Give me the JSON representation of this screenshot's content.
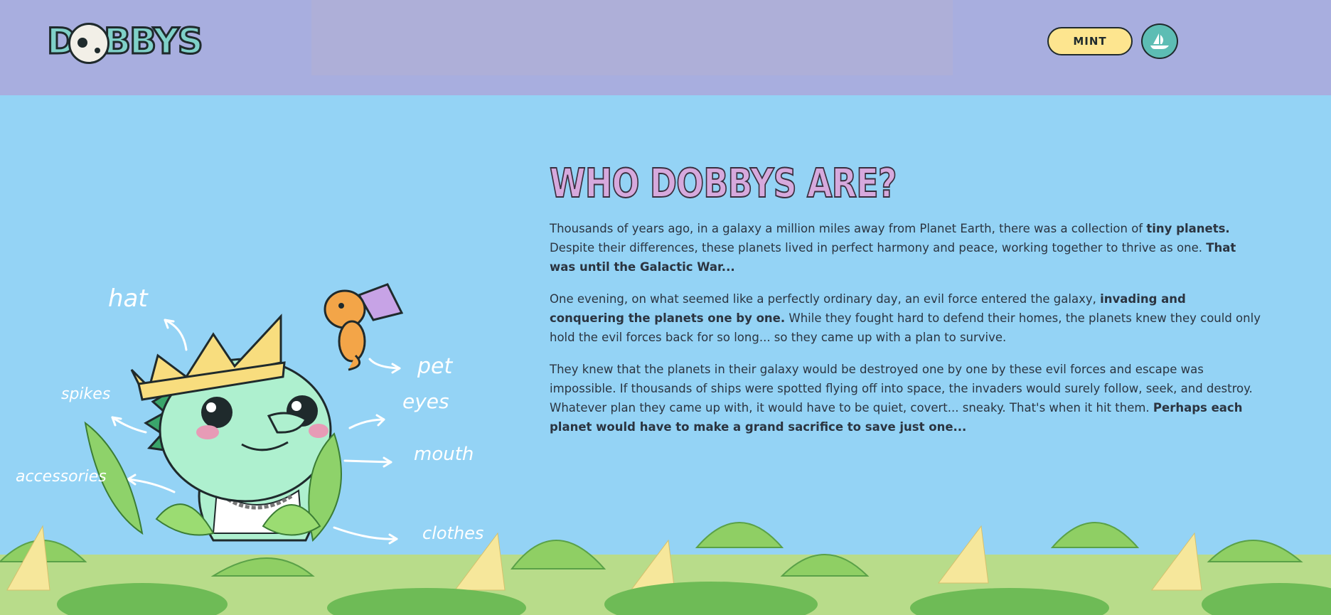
{
  "header": {
    "logo_text": "DOBBYS",
    "mint_label": "MINT",
    "opensea_icon": "opensea-ship-icon"
  },
  "section": {
    "title": "WHO DOBBYS ARE?",
    "p1_a": "Thousands of years ago, in a galaxy a million miles away from Planet Earth, there was a collection of ",
    "p1_b": "tiny planets.",
    "p1_c": " Despite their differences, these planets lived in perfect harmony and peace, working together to thrive as one. ",
    "p1_d": "That was until the Galactic War...",
    "p2_a": "One evening, on what seemed like a perfectly ordinary day, an evil force entered the galaxy, ",
    "p2_b": "invading and conquering the planets one by one.",
    "p2_c": " While they fought hard to defend their homes, the planets knew they could only hold the evil forces back for so long... so they came up with a plan to survive.",
    "p3_a": "They knew that the planets in their galaxy would be destroyed one by one by these evil forces and escape was impossible. If thousands of ships were spotted flying off into space, the invaders would surely follow, seek, and destroy. Whatever plan they came up with, it would have to be quiet, covert... sneaky. That's when it hit them. ",
    "p3_b": "Perhaps each planet would have to make a grand sacrifice to save just one..."
  },
  "illustration": {
    "labels": {
      "hat": "hat",
      "pet": "pet",
      "spikes": "spikes",
      "eyes": "eyes",
      "accessories": "accessories",
      "mouth": "mouth",
      "clothes": "clothes"
    }
  },
  "colors": {
    "header_bg": "#a8aedf",
    "page_bg": "#94d3f5",
    "mint_bg": "#fde58f",
    "title": "#d6a9dd",
    "dobby_green": "#aef0cf"
  }
}
